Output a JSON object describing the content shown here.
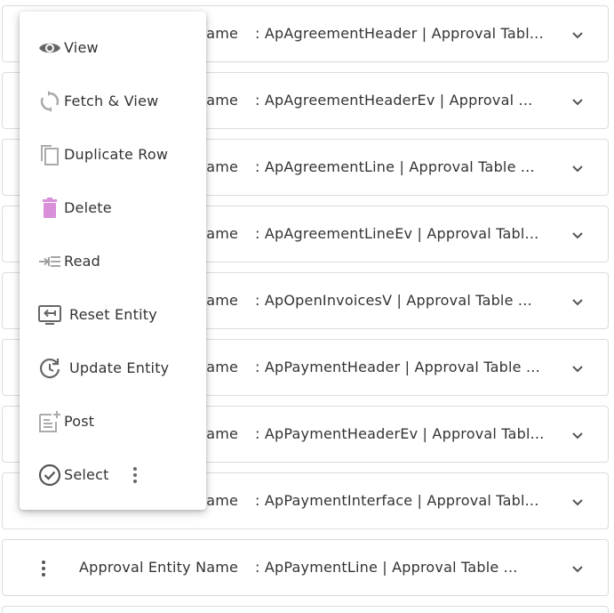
{
  "rows": [
    {
      "label": "Approval Entity Name",
      "separator": ":",
      "value": "ApAgreementHeader | Approval Tabl..."
    },
    {
      "label": "Approval Entity Name",
      "separator": ":",
      "value": "ApAgreementHeaderEv | Approval ..."
    },
    {
      "label": "Approval Entity Name",
      "separator": ":",
      "value": "ApAgreementLine | Approval Table ..."
    },
    {
      "label": "Approval Entity Name",
      "separator": ":",
      "value": "ApAgreementLineEv | Approval Tabl..."
    },
    {
      "label": "Approval Entity Name",
      "separator": ":",
      "value": "ApOpenInvoicesV | Approval Table ..."
    },
    {
      "label": "Approval Entity Name",
      "separator": ":",
      "value": "ApPaymentHeader | Approval Table ..."
    },
    {
      "label": "Approval Entity Name",
      "separator": ":",
      "value": "ApPaymentHeaderEv | Approval Tabl..."
    },
    {
      "label": "Approval Entity Name",
      "separator": ":",
      "value": "ApPaymentInterface | Approval Tabl..."
    },
    {
      "label": "Approval Entity Name",
      "separator": ":",
      "value": "ApPaymentLine | Approval Table ..."
    }
  ],
  "menu": {
    "items": [
      {
        "label": "View",
        "icon": "eye-icon"
      },
      {
        "label": "Fetch & View",
        "icon": "refresh-icon"
      },
      {
        "label": "Duplicate Row",
        "icon": "copy-icon"
      },
      {
        "label": "Delete",
        "icon": "trash-icon"
      },
      {
        "label": "Read",
        "icon": "indent-icon"
      },
      {
        "label": "Reset Entity",
        "icon": "reset-monitor-icon"
      },
      {
        "label": "Update Entity",
        "icon": "update-icon"
      },
      {
        "label": "Post",
        "icon": "post-icon"
      },
      {
        "label": "Select",
        "icon": "check-circle-icon"
      }
    ]
  },
  "colors": {
    "delete_icon": "#d98fd9",
    "icon_gray": "#666666",
    "text": "#333333",
    "border": "#dcdcdc"
  }
}
